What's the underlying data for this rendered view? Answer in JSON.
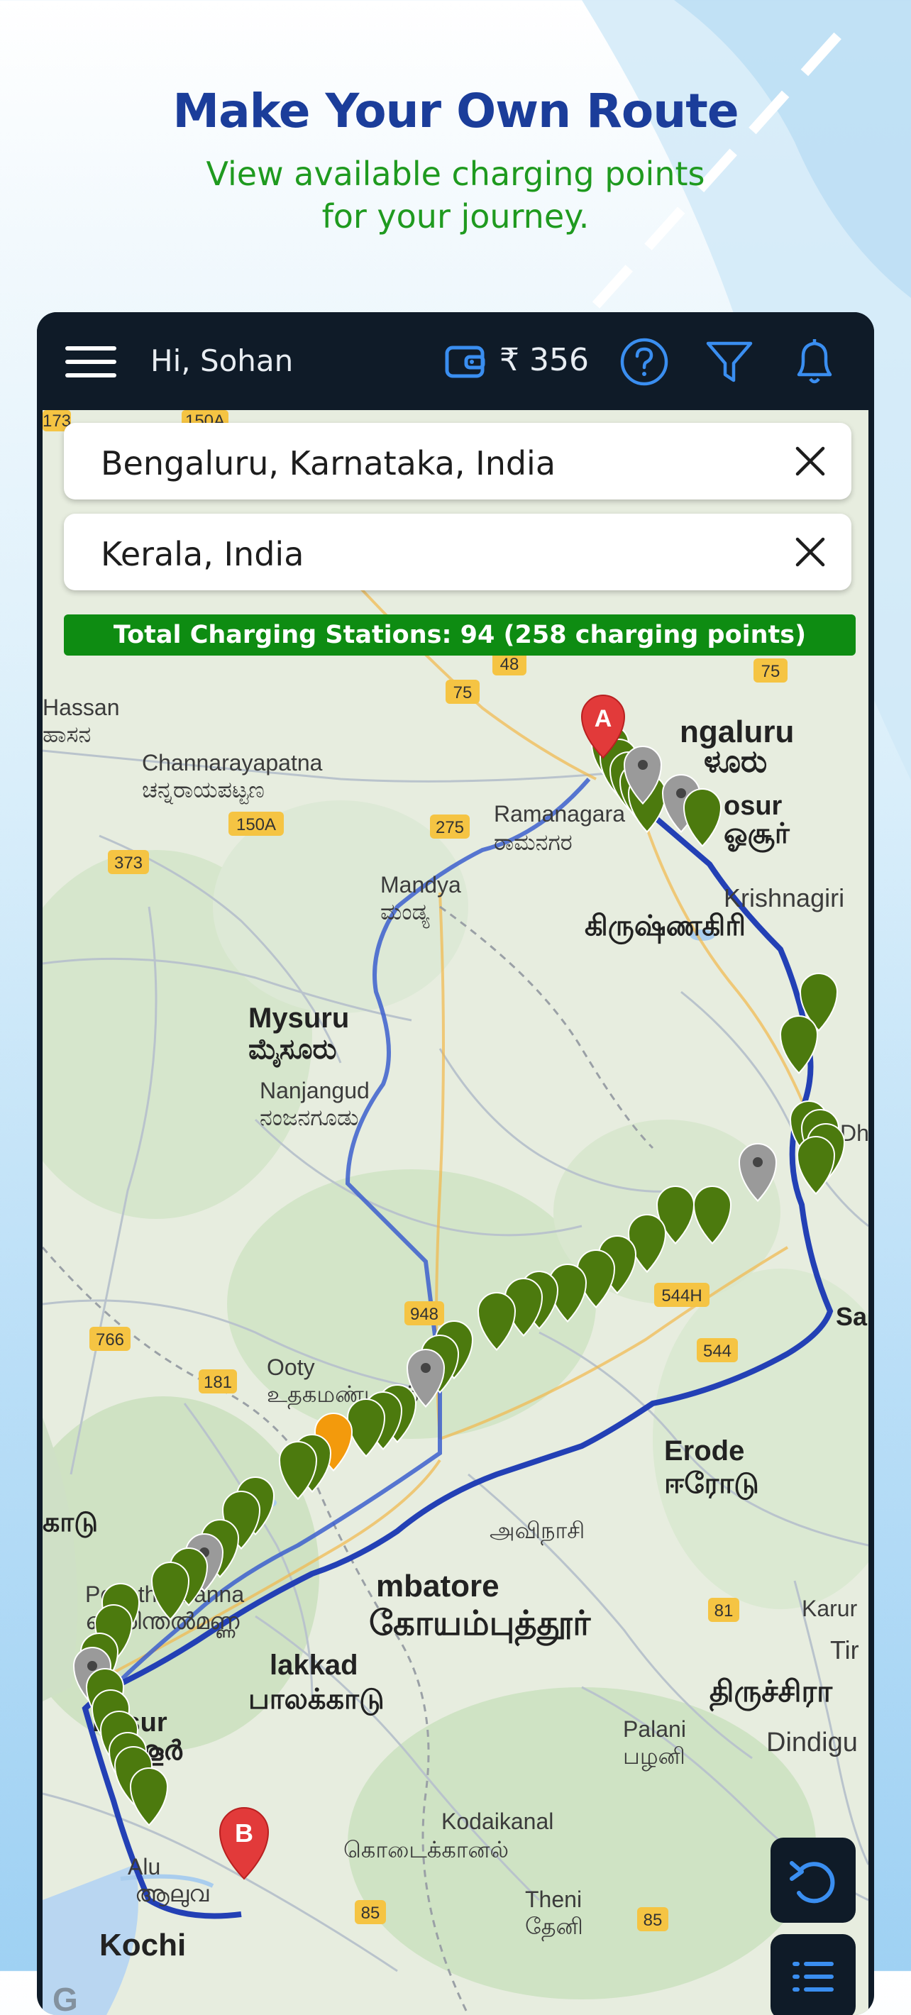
{
  "promo": {
    "headline": "Make Your Own Route",
    "subline": "View available charging points\nfor your journey."
  },
  "appbar": {
    "greeting": "Hi, Sohan",
    "wallet_balance": "₹ 356",
    "icons": [
      "menu-icon",
      "wallet-icon",
      "help-icon",
      "filter-icon",
      "bell-icon"
    ]
  },
  "route": {
    "origin": "Bengaluru, Karnataka, India",
    "destination": "Kerala, India",
    "summary": "Total Charging Stations: 94 (258 charging points)"
  },
  "map": {
    "start_marker": "A",
    "end_marker": "B",
    "places": [
      "Hassan",
      "ಹಾಸನ",
      "Channarayapatna",
      "ಚನ್ನರಾಯಪಟ್ಟಣ",
      "Mandya",
      "ಮಂಡ್ಯ",
      "Mysuru",
      "ಮೈಸೂರು",
      "Nanjangud",
      "ನಂಜನಗೂಡು",
      "Ramanagara",
      "ರಾಮನಗರ",
      "ngaluru",
      "ಳೂರು",
      "osur",
      "ஓசூர்",
      "Krishnagiri",
      "கிருஷ்ணகிரி",
      "Ooty",
      "உதகமண்டலம்",
      "Erode",
      "ஈரோடு",
      "அவிநாசி",
      "mbatore",
      "கோயம்புத்தூர்",
      "Perinthalmanna",
      "പെരിന്തൽമണ്ണ",
      "lakkad",
      "பாலக்காடு",
      "rissur",
      "ശൂർ",
      "Palani",
      "பழனி",
      "Kodaikanal",
      "கொடைக்கானல்",
      "Dindigu",
      "Theni",
      "தேனி",
      "Kochi",
      "Alu",
      "ആലുവ",
      "திருச்சிரா",
      "Karur",
      "Tir",
      "காடு",
      "Dh",
      "Sa"
    ],
    "road_shields": [
      "173",
      "150A",
      "48",
      "75",
      "75",
      "150A",
      "275",
      "373",
      "766",
      "181",
      "948",
      "544H",
      "544",
      "81",
      "85",
      "85"
    ]
  },
  "colors": {
    "brand_blue": "#1b3d9a",
    "brand_green": "#1f9a1f",
    "appbar_bg": "#0f1b28",
    "banner_green": "#0e8c12",
    "route_blue": "#2340b5",
    "marker_green": "#4c7a0e",
    "marker_gray": "#9a9a9a",
    "marker_orange": "#f39a0c",
    "marker_red": "#e23a3a"
  },
  "fabs": [
    "refresh-icon",
    "list-icon"
  ]
}
